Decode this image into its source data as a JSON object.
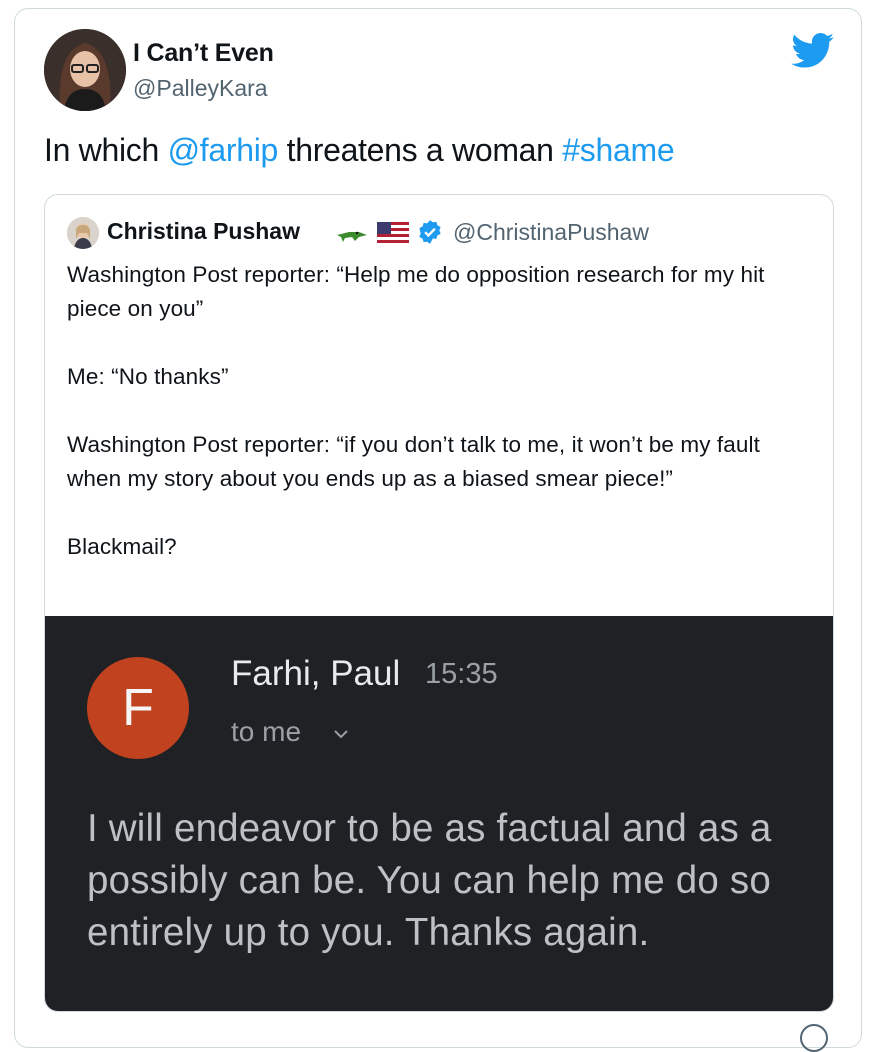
{
  "tweet": {
    "display_name": "I Can’t Even",
    "handle": "@PalleyKara",
    "text_parts": {
      "prefix": "In which ",
      "mention": "@farhip",
      "middle": " threatens a woman ",
      "hashtag": "#shame"
    }
  },
  "quoted_tweet": {
    "display_name": "Christina Pushaw",
    "handle": "@ChristinaPushaw",
    "emojis": [
      "crocodile",
      "us-flag"
    ],
    "verified": true,
    "body": [
      "Washington Post reporter: “Help me do opposition research for my hit piece on you”",
      "Me: “No thanks”",
      "Washington Post reporter: “if you don’t talk to me, it won’t be my fault when my story about you ends up as a biased smear piece!”",
      "Blackmail?"
    ]
  },
  "email_screenshot": {
    "avatar_letter": "F",
    "sender": "Farhi, Paul",
    "time": "15:35",
    "to": "to me",
    "body_lines": [
      "I will endeavor to be as factual and as a",
      "possibly can be. You can help me do so",
      "entirely up to you. Thanks again."
    ],
    "colors": {
      "background": "#202124",
      "avatar": "#c1421f"
    }
  },
  "colors": {
    "link": "#1d9bf0",
    "twitter_blue": "#1d9bf0",
    "muted": "#536471"
  },
  "icons": [
    "twitter-bird-icon",
    "verified-badge-icon",
    "chevron-down-icon"
  ]
}
